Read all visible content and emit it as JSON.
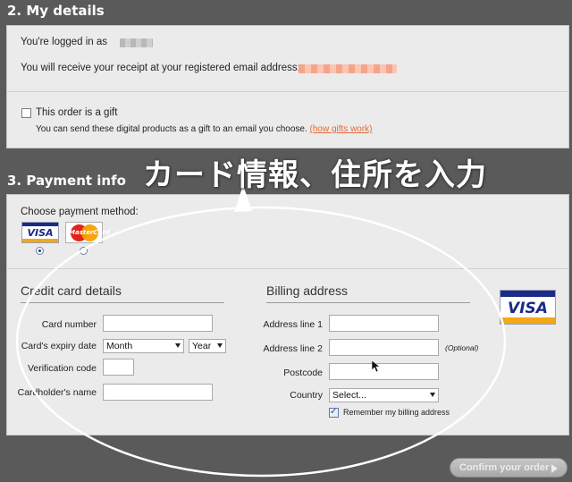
{
  "my_details": {
    "title": "2. My details",
    "logged_in_text": "You're logged in as",
    "receipt_text": "You will receive your receipt at your registered email address:",
    "gift_label": "This order is a gift",
    "gift_desc": "You can send these digital products as a gift to an email you choose.",
    "gift_link": "(how gifts work)",
    "gift_checked": false
  },
  "payment": {
    "title": "3. Payment info",
    "choose_label": "Choose payment method:",
    "methods": [
      {
        "name": "VISA",
        "selected": true
      },
      {
        "name": "MasterCard",
        "selected": false
      }
    ],
    "credit_card": {
      "title": "Credit card details",
      "card_number_label": "Card number",
      "expiry_label": "Card's expiry date",
      "month_value": "Month",
      "year_value": "Year",
      "verification_label": "Verification code",
      "holder_label": "Cardholder's name"
    },
    "billing": {
      "title": "Billing address",
      "line1_label": "Address line 1",
      "line2_label": "Address line 2",
      "optional_note": "(Optional)",
      "postcode_label": "Postcode",
      "country_label": "Country",
      "country_value": "Select...",
      "remember_label": "Remember my billing address",
      "remember_checked": true
    },
    "card_logo": "VISA"
  },
  "annotation": {
    "caption": "カード情報、住所を入力"
  },
  "confirm_button": "Confirm your order",
  "colors": {
    "page_bg": "#5a5a5a",
    "panel_bg": "#ebebeb",
    "link": "#e06a3a",
    "visa_blue": "#1a2a86",
    "visa_gold": "#f2a818"
  }
}
